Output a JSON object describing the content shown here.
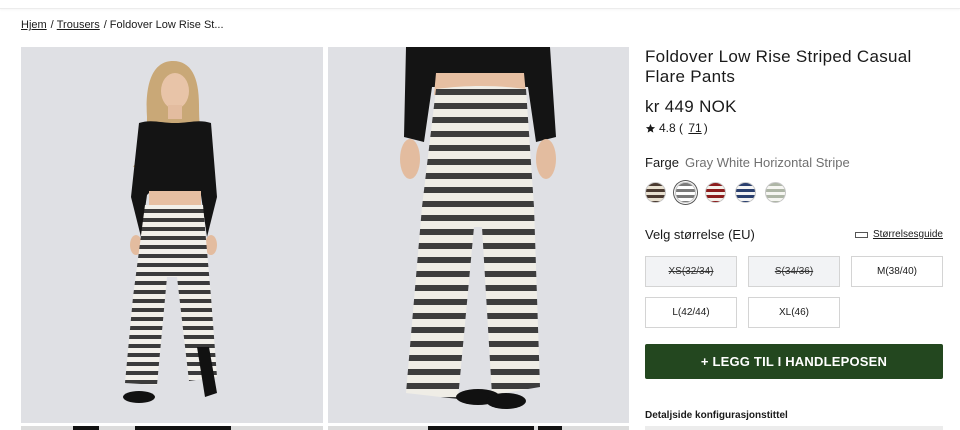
{
  "breadcrumb": {
    "home": "Hjem",
    "category": "Trousers",
    "current": "Foldover Low Rise St..."
  },
  "product": {
    "title": "Foldover Low Rise Striped Casual Flare Pants",
    "price": "kr 449 NOK",
    "rating": "4.8",
    "review_count": "71"
  },
  "color": {
    "label": "Farge",
    "selected": "Gray White Horizontal Stripe",
    "swatches": [
      {
        "name": "brown-beige-stripe",
        "colors": [
          "#4a3a30",
          "#e8e0d0"
        ],
        "selected": false
      },
      {
        "name": "gray-white-stripe",
        "colors": [
          "#7a7a7a",
          "#ffffff"
        ],
        "selected": true
      },
      {
        "name": "red-white-stripe",
        "colors": [
          "#8c1c1c",
          "#f4f0ea"
        ],
        "selected": false
      },
      {
        "name": "navy-white-stripe",
        "colors": [
          "#2a3f6e",
          "#f4f4f4"
        ],
        "selected": false
      },
      {
        "name": "sage-white-stripe",
        "colors": [
          "#aeb6a6",
          "#f6f6f2"
        ],
        "selected": false
      }
    ]
  },
  "size": {
    "label": "Velg størrelse (EU)",
    "guide_label": "Størrelsesguide",
    "options": [
      {
        "label": "XS(32/34)",
        "available": false
      },
      {
        "label": "S(34/36)",
        "available": false
      },
      {
        "label": "M(38/40)",
        "available": true
      },
      {
        "label": "L(42/44)",
        "available": true
      },
      {
        "label": "XL(46)",
        "available": true
      }
    ]
  },
  "cart": {
    "add_label": "+ LEGG TIL I HANDLEPOSEN",
    "button_color": "#23471f"
  },
  "details": {
    "config_heading": "Detaljside konfigurasjonstittel"
  },
  "icons": {
    "rating": "star-icon",
    "size_guide": "ruler-icon"
  }
}
